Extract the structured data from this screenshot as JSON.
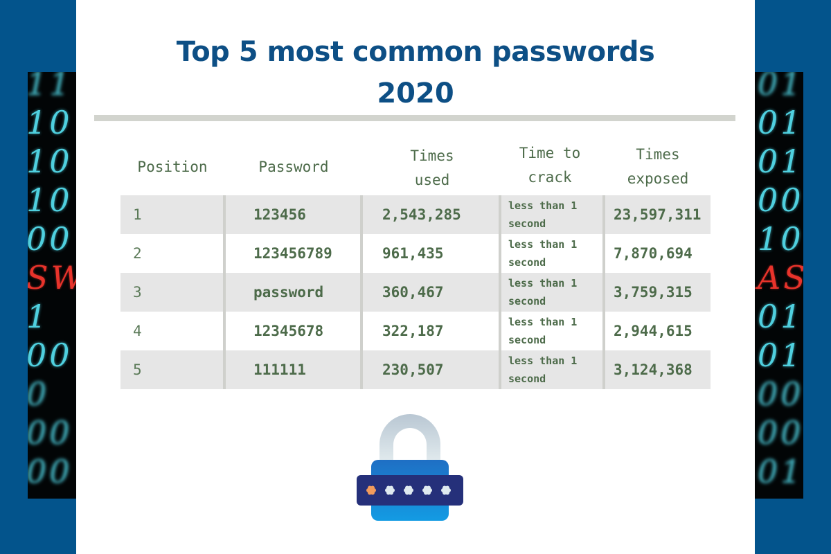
{
  "title": {
    "line1": "Top 5 most common passwords",
    "line2": "2020"
  },
  "colors": {
    "background": "#03548c",
    "title": "#0d4f85",
    "table_text": "#4d6b4a",
    "row_shade": "#e6e6e6",
    "divider": "#d2d4ce"
  },
  "side_images": {
    "left_rows": [
      "11",
      "10",
      "10",
      "10",
      "00",
      "SW",
      " 1",
      "00",
      "0",
      "00",
      "00"
    ],
    "right_rows": [
      "01",
      "01",
      "01",
      "00",
      "10",
      "AS",
      "01",
      "01",
      "00",
      "00",
      "01"
    ],
    "red_row_index": 5
  },
  "table": {
    "headers": {
      "position": "Position",
      "password": "Password",
      "times_used": [
        "Times",
        "used"
      ],
      "time_to_crack": [
        "Time to",
        "crack"
      ],
      "times_exposed": [
        "Times",
        "exposed"
      ]
    },
    "rows": [
      {
        "position": "1",
        "password": "123456",
        "times_used": "2,543,285",
        "time_to_crack": [
          "less than 1",
          "second"
        ],
        "times_exposed": "23,597,311"
      },
      {
        "position": "2",
        "password": "123456789",
        "times_used": "961,435",
        "time_to_crack": [
          "less than 1",
          "second"
        ],
        "times_exposed": "7,870,694"
      },
      {
        "position": "3",
        "password": "password",
        "times_used": "360,467",
        "time_to_crack": [
          "less than 1",
          "second"
        ],
        "times_exposed": "3,759,315"
      },
      {
        "position": "4",
        "password": "12345678",
        "times_used": "322,187",
        "time_to_crack": [
          "less than 1",
          "second"
        ],
        "times_exposed": "2,944,615"
      },
      {
        "position": "5",
        "password": "111111",
        "times_used": "230,507",
        "time_to_crack": [
          "less than 1",
          "second"
        ],
        "times_exposed": "3,124,368"
      }
    ]
  },
  "illustration": {
    "icon": "padlock-password-icon",
    "masked_chars": 5
  }
}
